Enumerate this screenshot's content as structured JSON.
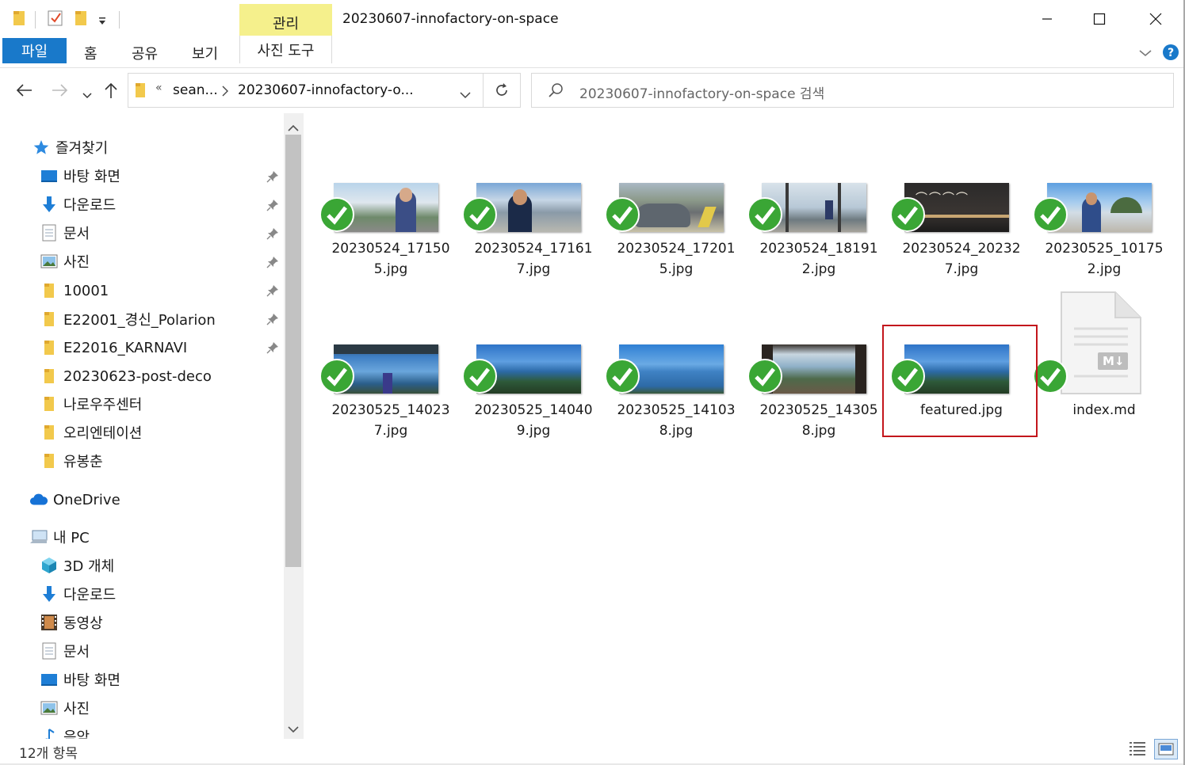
{
  "window": {
    "title": "20230607-innofactory-on-space",
    "contextual_group": "관리"
  },
  "ribbon": {
    "tabs": [
      "파일",
      "홈",
      "공유",
      "보기",
      "사진 도구"
    ]
  },
  "address": {
    "overflow": "«",
    "crumbs": [
      "sean...",
      "20230607-innofactory-o..."
    ],
    "search_placeholder": "20230607-innofactory-on-space 검색"
  },
  "nav": {
    "quick_access": {
      "label": "즐겨찾기",
      "items": [
        {
          "label": "바탕 화면",
          "icon": "desktop-icon",
          "pinned": true
        },
        {
          "label": "다운로드",
          "icon": "download-arrow-icon",
          "pinned": true
        },
        {
          "label": "문서",
          "icon": "document-icon",
          "pinned": true
        },
        {
          "label": "사진",
          "icon": "pictures-icon",
          "pinned": true
        },
        {
          "label": "10001",
          "icon": "folder-icon",
          "pinned": true
        },
        {
          "label": "E22001_경신_Polarion",
          "icon": "folder-icon",
          "pinned": true
        },
        {
          "label": "E22016_KARNAVI",
          "icon": "folder-icon",
          "pinned": true
        },
        {
          "label": "20230623-post-deco",
          "icon": "folder-icon",
          "pinned": false
        },
        {
          "label": "나로우주센터",
          "icon": "folder-icon",
          "pinned": false
        },
        {
          "label": "오리엔테이션",
          "icon": "folder-icon",
          "pinned": false
        },
        {
          "label": "유봉춘",
          "icon": "folder-icon",
          "pinned": false
        }
      ]
    },
    "onedrive": "OneDrive",
    "this_pc": {
      "label": "내 PC",
      "items": [
        {
          "label": "3D 개체",
          "icon": "cube-3d-icon"
        },
        {
          "label": "다운로드",
          "icon": "download-arrow-icon"
        },
        {
          "label": "동영상",
          "icon": "film-icon"
        },
        {
          "label": "문서",
          "icon": "document-icon"
        },
        {
          "label": "바탕 화면",
          "icon": "desktop-icon"
        },
        {
          "label": "사진",
          "icon": "pictures-icon"
        },
        {
          "label": "음악",
          "icon": "music-icon"
        }
      ]
    }
  },
  "files": [
    {
      "name": "20230524_171505.jpg",
      "line1": "20230524_17150",
      "line2": "5.jpg",
      "thumb": "thumb-person-building"
    },
    {
      "name": "20230524_171617.jpg",
      "line1": "20230524_17161",
      "line2": "7.jpg",
      "thumb": "thumb-person-smile"
    },
    {
      "name": "20230524_172015.jpg",
      "line1": "20230524_17201",
      "line2": "5.jpg",
      "thumb": "thumb-car"
    },
    {
      "name": "20230524_181912.jpg",
      "line1": "20230524_18191",
      "line2": "2.jpg",
      "thumb": "thumb-window-sea"
    },
    {
      "name": "20230524_202327.jpg",
      "line1": "20230524_20232",
      "line2": "7.jpg",
      "thumb": "thumb-restaurant-sign"
    },
    {
      "name": "20230525_101752.jpg",
      "line1": "20230525_10175",
      "line2": "2.jpg",
      "thumb": "thumb-person-beach"
    },
    {
      "name": "20230525_140237.jpg",
      "line1": "20230525_14023",
      "line2": "7.jpg",
      "thumb": "thumb-pavilion-sea"
    },
    {
      "name": "20230525_140409.jpg",
      "line1": "20230525_14040",
      "line2": "9.jpg",
      "thumb": "thumb-sea-forest"
    },
    {
      "name": "20230525_141038.jpg",
      "line1": "20230525_14103",
      "line2": "8.jpg",
      "thumb": "thumb-open-sea"
    },
    {
      "name": "20230525_143058.jpg",
      "line1": "20230525_14305",
      "line2": "8.jpg",
      "thumb": "thumb-terrace-sea"
    },
    {
      "name": "featured.jpg",
      "line1": "featured.jpg",
      "line2": "",
      "thumb": "thumb-sea-forest",
      "selected": true
    },
    {
      "name": "index.md",
      "line1": "index.md",
      "line2": "",
      "thumb": "markdown-file-icon"
    }
  ],
  "markdown_badge": "M↓",
  "status": {
    "count": "12개 항목"
  },
  "colors": {
    "file_tab": "#1979ca",
    "contextual_tab": "#f5f08c",
    "selection_border": "#c3161c",
    "sync_check": "#3aa635"
  }
}
